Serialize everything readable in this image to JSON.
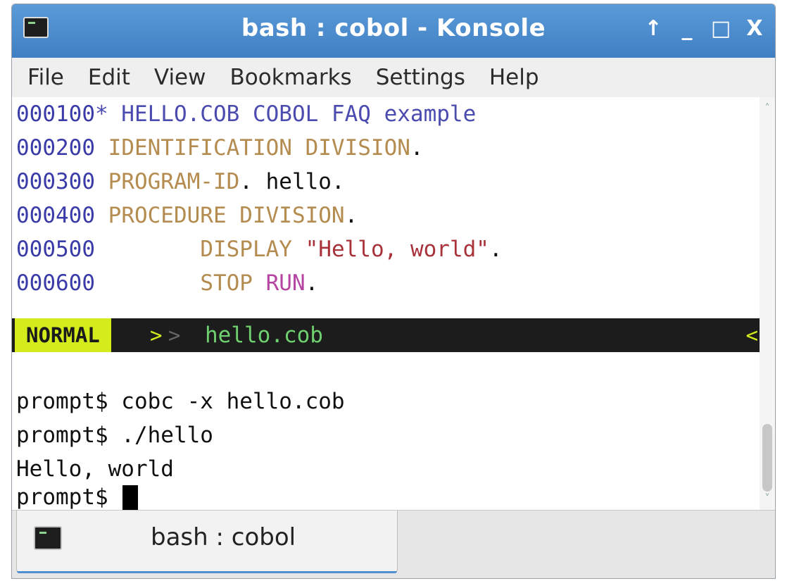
{
  "window": {
    "title": "bash : cobol - Konsole",
    "buttons": {
      "keep_above": "↑",
      "minimize": "_",
      "maximize": "□",
      "close": "X"
    }
  },
  "menu": [
    "File",
    "Edit",
    "View",
    "Bookmarks",
    "Settings",
    "Help"
  ],
  "code": {
    "l1": {
      "num": "000100",
      "rest": "* HELLO.COB COBOL FAQ example"
    },
    "l2": {
      "num": "000200",
      "kw": "IDENTIFICATION DIVISION",
      "end": "."
    },
    "l3": {
      "num": "000300",
      "kw": "PROGRAM-ID",
      "end": ". hello."
    },
    "l4": {
      "num": "000400",
      "kw": "PROCEDURE DIVISION",
      "end": "."
    },
    "l5": {
      "num": "000500",
      "indent": "       ",
      "kw": "DISPLAY",
      "str": "\"Hello, world\"",
      "end": "."
    },
    "l6": {
      "num": "000600",
      "indent": "       ",
      "kw": "STOP",
      "run": "RUN",
      "end": "."
    }
  },
  "statusline": {
    "mode": "NORMAL",
    "sep": ">",
    "sep2": ">",
    "file": "hello.cob",
    "right_sep": "<"
  },
  "shell": {
    "l1": "prompt$ cobc -x hello.cob",
    "l2": "prompt$ ./hello",
    "l3": "Hello, world",
    "l4": "prompt$ "
  },
  "tab": {
    "label": "bash : cobol"
  }
}
